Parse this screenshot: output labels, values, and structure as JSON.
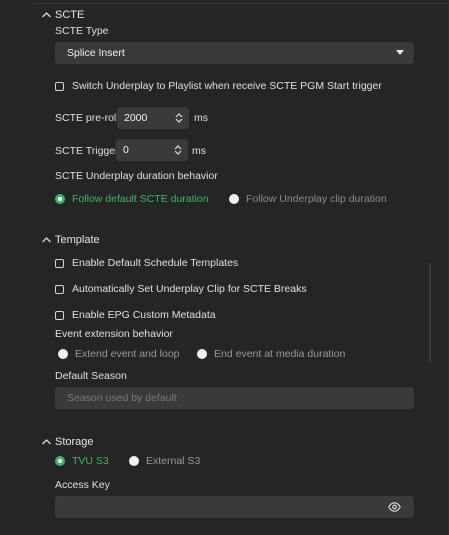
{
  "scte": {
    "heading": "SCTE",
    "type_label": "SCTE Type",
    "type_value": "Splice Insert",
    "switch_label": "Switch Underplay to Playlist when receive SCTE PGM Start trigger",
    "preroll_label": "SCTE pre-roll",
    "preroll_value": "2000",
    "preroll_unit": "ms",
    "trigger_label": "SCTE Trigger",
    "trigger_value": "0",
    "trigger_unit": "ms",
    "duration_label": "SCTE Underplay duration behavior",
    "duration_options": [
      "Follow default SCTE duration",
      "Follow Underplay clip duration"
    ],
    "duration_selected": 0
  },
  "template": {
    "heading": "Template",
    "enable_default_label": "Enable Default Schedule Templates",
    "auto_underplay_label": "Automatically Set Underplay Clip for SCTE Breaks",
    "epg_label": "Enable EPG Custom Metadata",
    "extension_label": "Event extension behavior",
    "extension_options": [
      "Extend event and loop",
      "End event at media duration"
    ],
    "season_label": "Default Season",
    "season_placeholder": "Season used by default"
  },
  "storage": {
    "heading": "Storage",
    "options": [
      "TVU S3",
      "External S3"
    ],
    "selected": 0,
    "access_key_label": "Access Key",
    "access_key_value": ""
  },
  "colors": {
    "accent": "#3fb46a",
    "background": "#252525",
    "field": "#3a3a3a"
  },
  "icons": {
    "collapse": "chevron-up-icon",
    "dropdown": "caret-down-icon",
    "spinner": "spinner-arrows-icon",
    "reveal": "eye-icon"
  }
}
